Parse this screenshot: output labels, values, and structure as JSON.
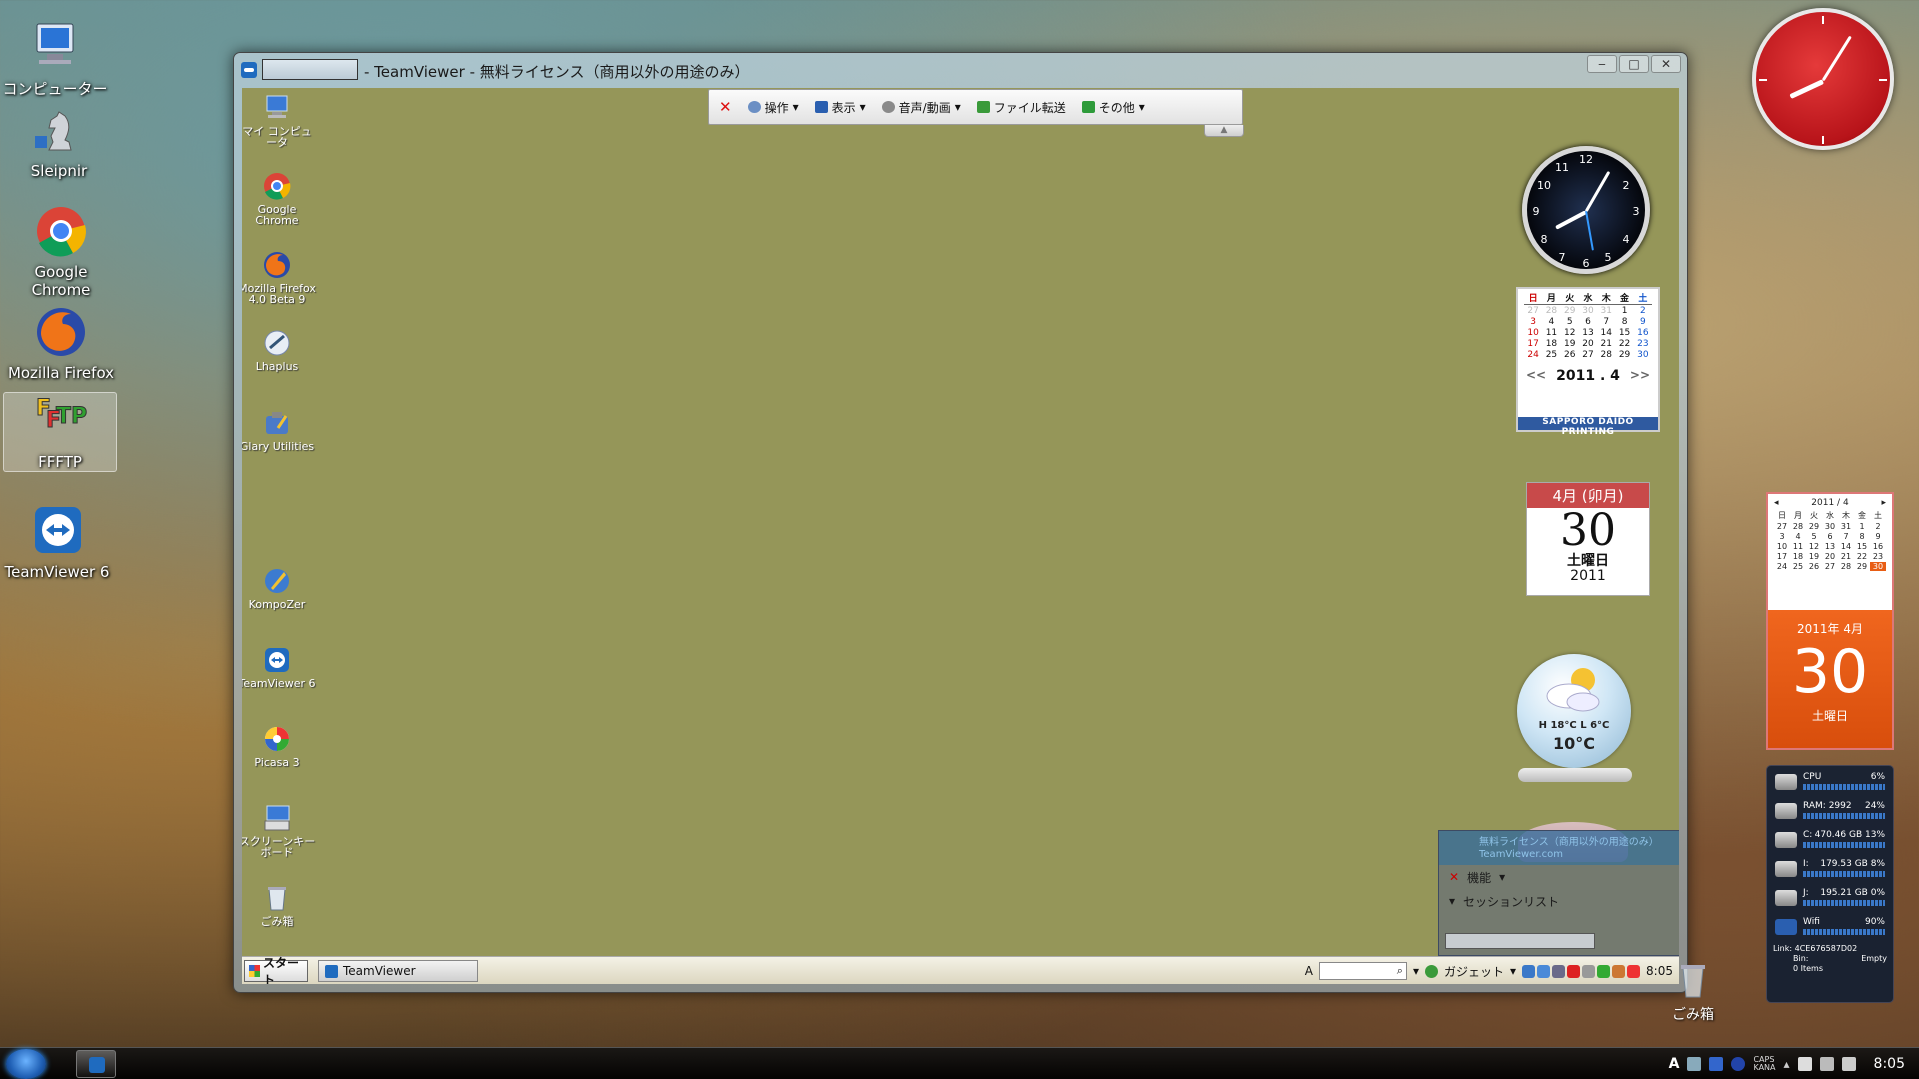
{
  "desktop": {
    "icons": [
      {
        "label": "コンピューター",
        "icon": "computer-icon"
      },
      {
        "label": "Sleipnir",
        "icon": "chess-knight-icon"
      },
      {
        "label": "Google Chrome",
        "icon": "chrome-icon"
      },
      {
        "label": "Mozilla Firefox",
        "icon": "firefox-icon"
      },
      {
        "label": "FFFTP",
        "icon": "ffftp-icon"
      },
      {
        "label": "TeamViewer 6",
        "icon": "teamviewer-icon"
      }
    ],
    "recycle_bin": "ごみ箱"
  },
  "teamviewer": {
    "title": "- TeamViewer - 無料ライセンス（商用以外の用途のみ）",
    "toolbar": {
      "close": "✕",
      "items": [
        "操作",
        "表示",
        "音声/動画",
        "ファイル転送",
        "その他"
      ]
    },
    "remote": {
      "icons": [
        {
          "label": "マイ コンピュータ"
        },
        {
          "label": "Google Chrome"
        },
        {
          "label": "Mozilla Firefox 4.0 Beta 9"
        },
        {
          "label": "Lhaplus"
        },
        {
          "label": "Glary Utilities"
        },
        {
          "label": "KompoZer"
        },
        {
          "label": "TeamViewer 6"
        },
        {
          "label": "Picasa 3"
        },
        {
          "label": "スクリーンキーボード"
        },
        {
          "label": "ごみ箱"
        }
      ],
      "taskbar": {
        "start": "スタート",
        "task": "TeamViewer",
        "gadget": "ガジェット",
        "time": "8:05"
      },
      "clock_numbers": [
        "12",
        "1",
        "2",
        "3",
        "4",
        "5",
        "6",
        "7",
        "8",
        "9",
        "10",
        "11"
      ],
      "calendar": {
        "headers": [
          "日",
          "月",
          "火",
          "水",
          "木",
          "金",
          "土"
        ],
        "days": [
          "27",
          "28",
          "29",
          "30",
          "31",
          "1",
          "2",
          "3",
          "4",
          "5",
          "6",
          "7",
          "8",
          "9",
          "10",
          "11",
          "12",
          "13",
          "14",
          "15",
          "16",
          "17",
          "18",
          "19",
          "20",
          "21",
          "22",
          "23",
          "24",
          "25",
          "26",
          "27",
          "28",
          "29",
          "30"
        ],
        "month": "2011 . 4",
        "prev": "<<",
        "next": ">>",
        "footer": "SAPPORO DAIDO PRINTING"
      },
      "day_calendar": {
        "header": "4月 (卯月)",
        "day": "30",
        "weekday": "土曜日",
        "year": "2011"
      },
      "weather": {
        "hilo": "H 18°C L 6°C",
        "temp": "10°C"
      },
      "panel": {
        "line1": "無料ライセンス（商用以外の用途のみ）",
        "line2": "TeamViewer.com",
        "features": "機能",
        "session_list": "セッションリスト"
      }
    }
  },
  "gadgets": {
    "mini_calendar": {
      "month": "2011 / 4",
      "headers": [
        "日",
        "月",
        "火",
        "水",
        "木",
        "金",
        "土"
      ],
      "days": [
        "27",
        "28",
        "29",
        "30",
        "31",
        "1",
        "2",
        "3",
        "4",
        "5",
        "6",
        "7",
        "8",
        "9",
        "10",
        "11",
        "12",
        "13",
        "14",
        "15",
        "16",
        "17",
        "18",
        "19",
        "20",
        "21",
        "22",
        "23",
        "24",
        "25",
        "26",
        "27",
        "28",
        "29",
        "30"
      ],
      "ym": "2011年 4月",
      "day": "30",
      "weekday": "土曜日"
    },
    "sysmon": {
      "cpu_label": "CPU",
      "cpu_value": "6%",
      "ram_label": "RAM: 2992",
      "ram_value": "24%",
      "c_label": "C:",
      "c_value": "470.46 GB 13%",
      "d_label": "I:",
      "d_value": "179.53 GB 8%",
      "e_label": "J:",
      "e_value": "195.21 GB 0%",
      "wifi_label": "Wifi",
      "wifi_value": "90%",
      "link": "Link: 4CE676587D02",
      "bin_label": "Bin:",
      "bin_value": "Empty",
      "items": "0 Items"
    }
  },
  "taskbar": {
    "time": "8:05",
    "caps": "CAPS",
    "kana": "KANA",
    "ime": "A"
  },
  "colors": {
    "remote_background": "#959659",
    "tv_blue": "#1f6bbf",
    "orange": "#e85d14"
  }
}
